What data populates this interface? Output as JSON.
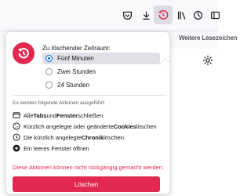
{
  "toolbar": {
    "icons": [
      "pocket-icon",
      "download-icon",
      "extensions-icon",
      "forget-icon",
      "library-icon",
      "history-icon",
      "sidebar-icon"
    ],
    "bookmarks_label": "Weitere Lesezeichen"
  },
  "panel": {
    "range_title": "Zu löschender Zeitraum:",
    "options": [
      "Fünf Minuten",
      "Zwei Stunden",
      "24 Stunden"
    ],
    "selected": "Fünf Minuten",
    "actions_heading": "Es werden folgende Aktionen ausgeführt:",
    "actions": [
      {
        "pre": "Alle ",
        "b1": "Tabs",
        "mid": " und ",
        "b2": "Fenster",
        "post": " schließen"
      },
      {
        "pre": "Kürzlich angelegte oder geänderte ",
        "b1": "Cookies",
        "mid": "",
        "b2": "",
        "post": " löschen"
      },
      {
        "pre": "Die kürzlich angelegte ",
        "b1": "Chronik",
        "mid": "",
        "b2": "",
        "post": " löschen"
      },
      {
        "pre": "Ein leeres Fenster öffnen",
        "b1": "",
        "mid": "",
        "b2": "",
        "post": ""
      }
    ],
    "warning": "Diese Aktionen können nicht rückgängig gemacht werden.",
    "delete_label": "Löschen"
  },
  "colors": {
    "accent": "#e22850",
    "radio": "#0061e0"
  }
}
